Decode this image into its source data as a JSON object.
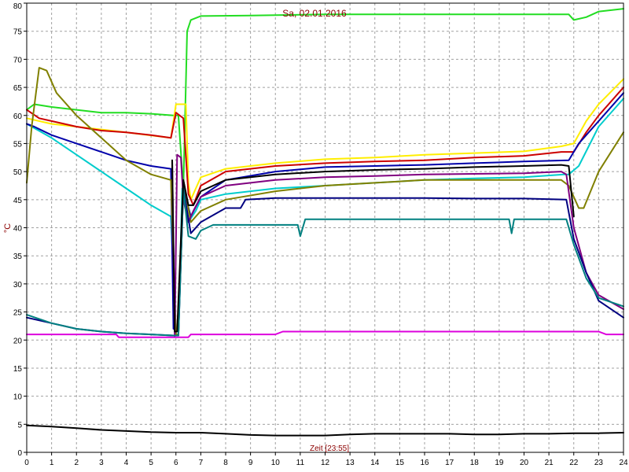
{
  "chart_data": {
    "type": "line",
    "title": "Sa, 02.01.2016",
    "xlabel": "Zeit [23:55]",
    "ylabel": "°C",
    "xlim": [
      0,
      24
    ],
    "ylim": [
      0,
      80
    ],
    "x_ticks": [
      "0",
      "1",
      "2",
      "3",
      "4",
      "5",
      "6",
      "7",
      "8",
      "9",
      "10",
      "11",
      "12",
      "13",
      "14",
      "15",
      "16",
      "17",
      "18",
      "19",
      "20",
      "21",
      "22",
      "23",
      "24"
    ],
    "y_ticks": [
      "0",
      "5",
      "10",
      "15",
      "20",
      "25",
      "30",
      "35",
      "40",
      "45",
      "50",
      "55",
      "60",
      "65",
      "70",
      "75",
      "80"
    ],
    "grid": true,
    "series": [
      {
        "color": "#22dd22",
        "points": [
          [
            0,
            61
          ],
          [
            0.3,
            62
          ],
          [
            1,
            61.5
          ],
          [
            2,
            61
          ],
          [
            3,
            60.5
          ],
          [
            4,
            60.5
          ],
          [
            5,
            60.3
          ],
          [
            5.9,
            60
          ],
          [
            6.1,
            60
          ],
          [
            6.3,
            47
          ],
          [
            6.45,
            75
          ],
          [
            6.6,
            77
          ],
          [
            7,
            77.7
          ],
          [
            9,
            77.8
          ],
          [
            12,
            78
          ],
          [
            16,
            78
          ],
          [
            21,
            78
          ],
          [
            21.8,
            78
          ],
          [
            22,
            77
          ],
          [
            22.5,
            77.5
          ],
          [
            23,
            78.5
          ],
          [
            24,
            79
          ]
        ]
      },
      {
        "color": "#ffee00",
        "points": [
          [
            0,
            59.5
          ],
          [
            1,
            58.5
          ],
          [
            2,
            58
          ],
          [
            4,
            57
          ],
          [
            5.8,
            56
          ],
          [
            6,
            62
          ],
          [
            6.4,
            62
          ],
          [
            6.5,
            48
          ],
          [
            6.6,
            45
          ],
          [
            7,
            49
          ],
          [
            8,
            50.5
          ],
          [
            10,
            51.5
          ],
          [
            12,
            52.2
          ],
          [
            14,
            52.5
          ],
          [
            16,
            53
          ],
          [
            18,
            53.3
          ],
          [
            20,
            53.6
          ],
          [
            21.5,
            54.5
          ],
          [
            22,
            55
          ],
          [
            22.5,
            59
          ],
          [
            23,
            62
          ],
          [
            24,
            66.5
          ]
        ]
      },
      {
        "color": "#cc0000",
        "points": [
          [
            0,
            61
          ],
          [
            0.5,
            59.5
          ],
          [
            1,
            59
          ],
          [
            2,
            58
          ],
          [
            3,
            57.3
          ],
          [
            4,
            57
          ],
          [
            5,
            56.5
          ],
          [
            5.8,
            56
          ],
          [
            6,
            60.5
          ],
          [
            6.3,
            59.5
          ],
          [
            6.5,
            46
          ],
          [
            6.7,
            44
          ],
          [
            7,
            47.5
          ],
          [
            8,
            50
          ],
          [
            10,
            51
          ],
          [
            12,
            51.5
          ],
          [
            14,
            51.8
          ],
          [
            16,
            52
          ],
          [
            18,
            52.5
          ],
          [
            20,
            52.8
          ],
          [
            21.5,
            53.5
          ],
          [
            22,
            53.5
          ],
          [
            22.5,
            57
          ],
          [
            23,
            60
          ],
          [
            24,
            65
          ]
        ]
      },
      {
        "color": "#00cccc",
        "points": [
          [
            0,
            58.5
          ],
          [
            1,
            56
          ],
          [
            2,
            53
          ],
          [
            3,
            50
          ],
          [
            4,
            47
          ],
          [
            5,
            44
          ],
          [
            5.8,
            42
          ],
          [
            6,
            21
          ],
          [
            6.1,
            21
          ],
          [
            6.25,
            47
          ],
          [
            6.5,
            41
          ],
          [
            6.8,
            43
          ],
          [
            7,
            45
          ],
          [
            8,
            46
          ],
          [
            9,
            46.5
          ],
          [
            10,
            47
          ],
          [
            12,
            47.5
          ],
          [
            14,
            48
          ],
          [
            16,
            48.5
          ],
          [
            18,
            48.8
          ],
          [
            20,
            49
          ],
          [
            21.6,
            49.5
          ],
          [
            21.8,
            49.5
          ],
          [
            22.2,
            51
          ],
          [
            23,
            58
          ],
          [
            24,
            63
          ]
        ]
      },
      {
        "color": "#0000aa",
        "points": [
          [
            0,
            58.5
          ],
          [
            0.3,
            58
          ],
          [
            1,
            56.5
          ],
          [
            2,
            55
          ],
          [
            3,
            53.5
          ],
          [
            4,
            52
          ],
          [
            5,
            51
          ],
          [
            5.8,
            50.5
          ],
          [
            5.9,
            22
          ],
          [
            6.1,
            22
          ],
          [
            6.3,
            47
          ],
          [
            6.6,
            42
          ],
          [
            7,
            45.5
          ],
          [
            8,
            48.5
          ],
          [
            10,
            50
          ],
          [
            12,
            50.8
          ],
          [
            14,
            51
          ],
          [
            16,
            51.2
          ],
          [
            18,
            51.5
          ],
          [
            20,
            51.8
          ],
          [
            21.8,
            52
          ],
          [
            22.2,
            55
          ],
          [
            23,
            59
          ],
          [
            24,
            64
          ]
        ]
      },
      {
        "color": "#808000",
        "points": [
          [
            0,
            48
          ],
          [
            0.2,
            58
          ],
          [
            0.5,
            68.5
          ],
          [
            0.8,
            68
          ],
          [
            1.2,
            64
          ],
          [
            2,
            60
          ],
          [
            3,
            56
          ],
          [
            4,
            52
          ],
          [
            5,
            49.5
          ],
          [
            5.8,
            48.5
          ],
          [
            6,
            21
          ],
          [
            6.1,
            21
          ],
          [
            6.3,
            48.5
          ],
          [
            6.6,
            41
          ],
          [
            7,
            43
          ],
          [
            8,
            45
          ],
          [
            10,
            46.5
          ],
          [
            12,
            47.5
          ],
          [
            14,
            48
          ],
          [
            16,
            48.5
          ],
          [
            18,
            48.5
          ],
          [
            20,
            48.5
          ],
          [
            21.5,
            48.5
          ],
          [
            21.8,
            47.5
          ],
          [
            22.2,
            43.5
          ],
          [
            22.4,
            43.5
          ],
          [
            23,
            50
          ],
          [
            24,
            57
          ]
        ]
      },
      {
        "color": "#800080",
        "points": [
          [
            5.85,
            52
          ],
          [
            5.95,
            20.5
          ],
          [
            6.05,
            53
          ],
          [
            6.2,
            52.5
          ],
          [
            6.3,
            45
          ],
          [
            6.5,
            41
          ],
          [
            6.7,
            43
          ],
          [
            7,
            45.5
          ],
          [
            8,
            47.5
          ],
          [
            10,
            48.5
          ],
          [
            12,
            49
          ],
          [
            14,
            49.2
          ],
          [
            16,
            49.5
          ],
          [
            18,
            49.6
          ],
          [
            20,
            49.7
          ],
          [
            21.5,
            50
          ],
          [
            21.7,
            49.5
          ],
          [
            22,
            40
          ],
          [
            22.5,
            32
          ],
          [
            23,
            28
          ],
          [
            24,
            25.5
          ]
        ]
      },
      {
        "color": "#000080",
        "points": [
          [
            0,
            24
          ],
          [
            1,
            23
          ],
          [
            2,
            22
          ],
          [
            3,
            21.5
          ],
          [
            4,
            21.2
          ],
          [
            5,
            21
          ],
          [
            5.9,
            20.8
          ],
          [
            6.1,
            20.8
          ],
          [
            6.3,
            47
          ],
          [
            6.6,
            39
          ],
          [
            7,
            41
          ],
          [
            8,
            43.5
          ],
          [
            8.6,
            43.5
          ],
          [
            8.8,
            45
          ],
          [
            10,
            45.3
          ],
          [
            12,
            45.3
          ],
          [
            14,
            45.3
          ],
          [
            16,
            45.3
          ],
          [
            18,
            45.2
          ],
          [
            20,
            45.2
          ],
          [
            21.7,
            45
          ],
          [
            22,
            38
          ],
          [
            22.5,
            32
          ],
          [
            23,
            27
          ],
          [
            24,
            24
          ]
        ]
      },
      {
        "color": "#008080",
        "points": [
          [
            0,
            24.5
          ],
          [
            1,
            23
          ],
          [
            2,
            22
          ],
          [
            3,
            21.5
          ],
          [
            4,
            21.2
          ],
          [
            5,
            21
          ],
          [
            5.9,
            20.8
          ],
          [
            6.1,
            20.8
          ],
          [
            6.3,
            47
          ],
          [
            6.5,
            38.5
          ],
          [
            6.8,
            38
          ],
          [
            7,
            39.5
          ],
          [
            7.5,
            40.5
          ],
          [
            8,
            40.5
          ],
          [
            9,
            40.5
          ],
          [
            10,
            40.5
          ],
          [
            10.9,
            40.5
          ],
          [
            11,
            38.5
          ],
          [
            11.2,
            41.5
          ],
          [
            12,
            41.5
          ],
          [
            14,
            41.5
          ],
          [
            16,
            41.5
          ],
          [
            18,
            41.5
          ],
          [
            19.4,
            41.5
          ],
          [
            19.5,
            39
          ],
          [
            19.6,
            41.5
          ],
          [
            21.7,
            41.5
          ],
          [
            22,
            37
          ],
          [
            22.5,
            31
          ],
          [
            23,
            27.5
          ],
          [
            24,
            26
          ]
        ]
      },
      {
        "color": "#000000",
        "points": [
          [
            5.85,
            52
          ],
          [
            5.95,
            21.5
          ],
          [
            6.05,
            21.5
          ],
          [
            6.3,
            48.5
          ],
          [
            6.5,
            44
          ],
          [
            6.7,
            44
          ],
          [
            7,
            46.5
          ],
          [
            8,
            48.5
          ],
          [
            10,
            49.5
          ],
          [
            12,
            50
          ],
          [
            14,
            50.3
          ],
          [
            16,
            50.5
          ],
          [
            18,
            50.8
          ],
          [
            20,
            51
          ],
          [
            21.5,
            51.2
          ],
          [
            21.8,
            51
          ],
          [
            22,
            42
          ]
        ]
      },
      {
        "color": "#dd00dd",
        "points": [
          [
            0,
            21
          ],
          [
            3,
            21
          ],
          [
            3.6,
            21
          ],
          [
            3.7,
            20.5
          ],
          [
            5,
            20.5
          ],
          [
            6,
            20.5
          ],
          [
            6.5,
            20.5
          ],
          [
            6.6,
            21
          ],
          [
            10,
            21
          ],
          [
            10.3,
            21.5
          ],
          [
            14,
            21.5
          ],
          [
            18,
            21.5
          ],
          [
            21,
            21.5
          ],
          [
            23,
            21.5
          ],
          [
            23.3,
            21
          ],
          [
            24,
            21
          ]
        ]
      },
      {
        "color": "#000000",
        "points": [
          [
            0,
            4.8
          ],
          [
            1,
            4.6
          ],
          [
            2,
            4.3
          ],
          [
            3,
            4
          ],
          [
            4,
            3.8
          ],
          [
            5,
            3.6
          ],
          [
            6,
            3.5
          ],
          [
            7,
            3.5
          ],
          [
            8,
            3.3
          ],
          [
            9,
            3.1
          ],
          [
            10,
            3
          ],
          [
            11,
            3
          ],
          [
            12,
            3
          ],
          [
            13,
            3.2
          ],
          [
            14,
            3.3
          ],
          [
            15,
            3.3
          ],
          [
            16,
            3.3
          ],
          [
            17,
            3.3
          ],
          [
            18,
            3.2
          ],
          [
            19,
            3.2
          ],
          [
            20,
            3.3
          ],
          [
            21,
            3.3
          ],
          [
            22,
            3.4
          ],
          [
            23,
            3.4
          ],
          [
            24,
            3.5
          ]
        ]
      }
    ]
  }
}
